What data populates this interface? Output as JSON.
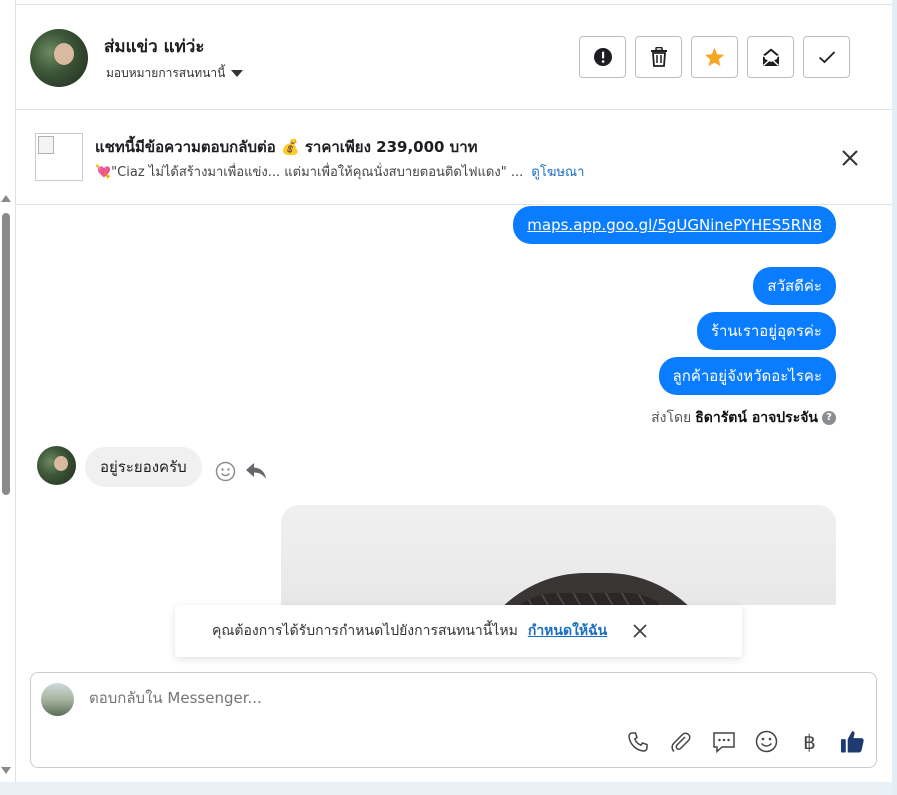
{
  "header": {
    "contact_name": "ส่มแข่ว แท่ว่ะ",
    "assign_label": "มอบหมายการสนทนานี้",
    "actions": [
      {
        "name": "spam-button",
        "icon": "alert-icon"
      },
      {
        "name": "delete-button",
        "icon": "trash-icon"
      },
      {
        "name": "star-button",
        "icon": "star-icon"
      },
      {
        "name": "mark-unread-button",
        "icon": "envelope-icon"
      },
      {
        "name": "done-button",
        "icon": "check-icon"
      }
    ],
    "star_color": "#f5a623"
  },
  "ad_banner": {
    "title": "แชทนี้มีข้อความตอบกลับต่อ 💰 ราคาเพียง 239,000 บาท",
    "text": "💘\"Ciaz ไม่ได้สร้างมาเพื่อแข่ง... แต่มาเพื่อให้คุณนั่งสบายตอนติดไฟแดง\" ...",
    "link": "ดูโฆษณา"
  },
  "messages": {
    "outgoing": [
      "maps.app.goo.gl/5gUGNinePYHES5RN8",
      "สวัสดีค่ะ",
      "ร้านเราอยู่อุดรค่ะ",
      "ลูกค้าอยู่จังหวัดอะไรคะ"
    ],
    "sent_by_prefix": "ส่งโดย",
    "sent_by_name": "ธิดารัตน์ อาจประจัน",
    "help_mark": "?",
    "incoming": "อยู่ระยองครับ",
    "bubble_color": "#0a7cff"
  },
  "assign_toast": {
    "text": "คุณต้องการได้รับการกำหนดไปยังการสนทนานี้ไหม",
    "link": "กำหนดให้ฉัน"
  },
  "composer": {
    "placeholder": "ตอบกลับใน Messenger...",
    "baht_symbol": "฿",
    "tools": [
      "phone-icon",
      "paperclip-icon",
      "saved-reply-icon",
      "emoji-icon",
      "baht-icon",
      "thumbs-up-icon"
    ]
  }
}
